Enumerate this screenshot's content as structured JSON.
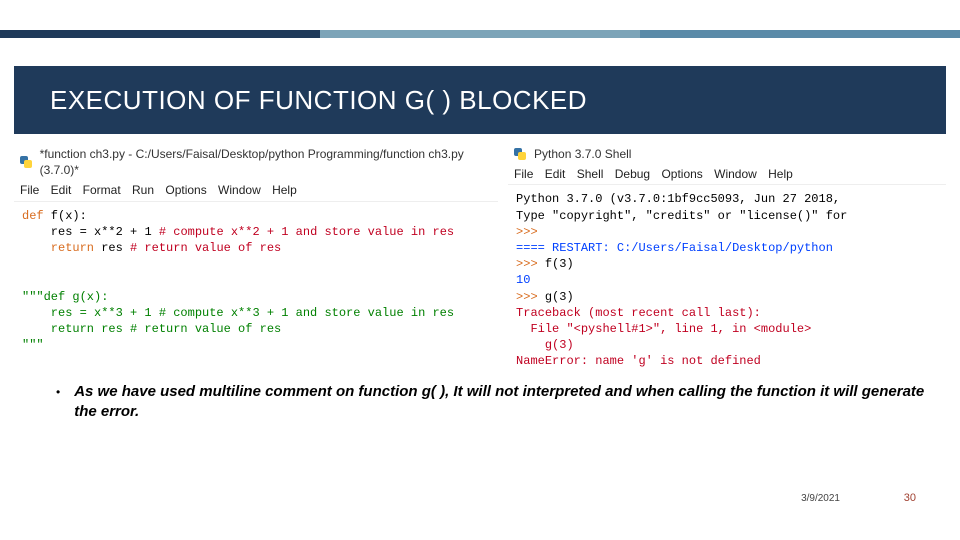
{
  "slide": {
    "title": "EXECUTION OF FUNCTION G( ) BLOCKED",
    "bullet": "As we have used multiline comment on function g( ), It will not interpreted and when calling the function it will generate the error.",
    "date": "3/9/2021",
    "page_number": "30"
  },
  "editor": {
    "window_title": "*function ch3.py - C:/Users/Faisal/Desktop/python Programming/function ch3.py (3.7.0)*",
    "menu": "File   Edit   Format   Run   Options   Window   Help",
    "code": {
      "l1_def": "def",
      "l1_rest": " f(x):",
      "l2a": "    res = x**",
      "l2num": "2",
      "l2b": " + ",
      "l2num2": "1",
      "l2comment": " # compute x**2 + 1 and store value in res",
      "l3_return": "    return",
      "l3_rest": " res ",
      "l3_comment": "# return value of res",
      "blank1": "",
      "blank2": "",
      "l5_open": "\"\"\"def g(x):",
      "l6": "    res = x**3 + 1 # compute x**3 + 1 and store value in res",
      "l7": "    return res # return value of res",
      "l8_close": "\"\"\""
    }
  },
  "shell": {
    "window_title": "Python 3.7.0 Shell",
    "menu": "File   Edit   Shell   Debug   Options   Window   Help",
    "out": {
      "l1": "Python 3.7.0 (v3.7.0:1bf9cc5093, Jun 27 2018,",
      "l2": "Type \"copyright\", \"credits\" or \"license()\" for",
      "p1": ">>>",
      "l3": "==== RESTART: C:/Users/Faisal/Desktop/python ",
      "p2": ">>> ",
      "call1": "f(3)",
      "res1": "10",
      "p3": ">>> ",
      "call2": "g(3)",
      "tb1": "Traceback (most recent call last):",
      "tb2": "  File \"<pyshell#1>\", line 1, in <module>",
      "tb3": "    g(3)",
      "tb4": "NameError: name 'g' is not defined"
    }
  }
}
